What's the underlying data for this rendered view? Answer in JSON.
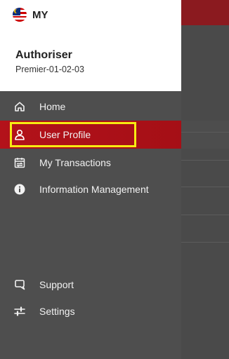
{
  "header": {
    "country_code": "MY",
    "user_role": "Authoriser",
    "user_id": "Premier-01-02-03"
  },
  "menu": {
    "home": "Home",
    "user_profile": "User Profile",
    "my_transactions": "My Transactions",
    "information_management": "Information Management",
    "support": "Support",
    "settings": "Settings"
  },
  "colors": {
    "drawer_bg": "#4e4e4e",
    "active_item": "#b3121a",
    "highlight": "#f7ec12",
    "brand_bar": "#8b1a1f"
  }
}
